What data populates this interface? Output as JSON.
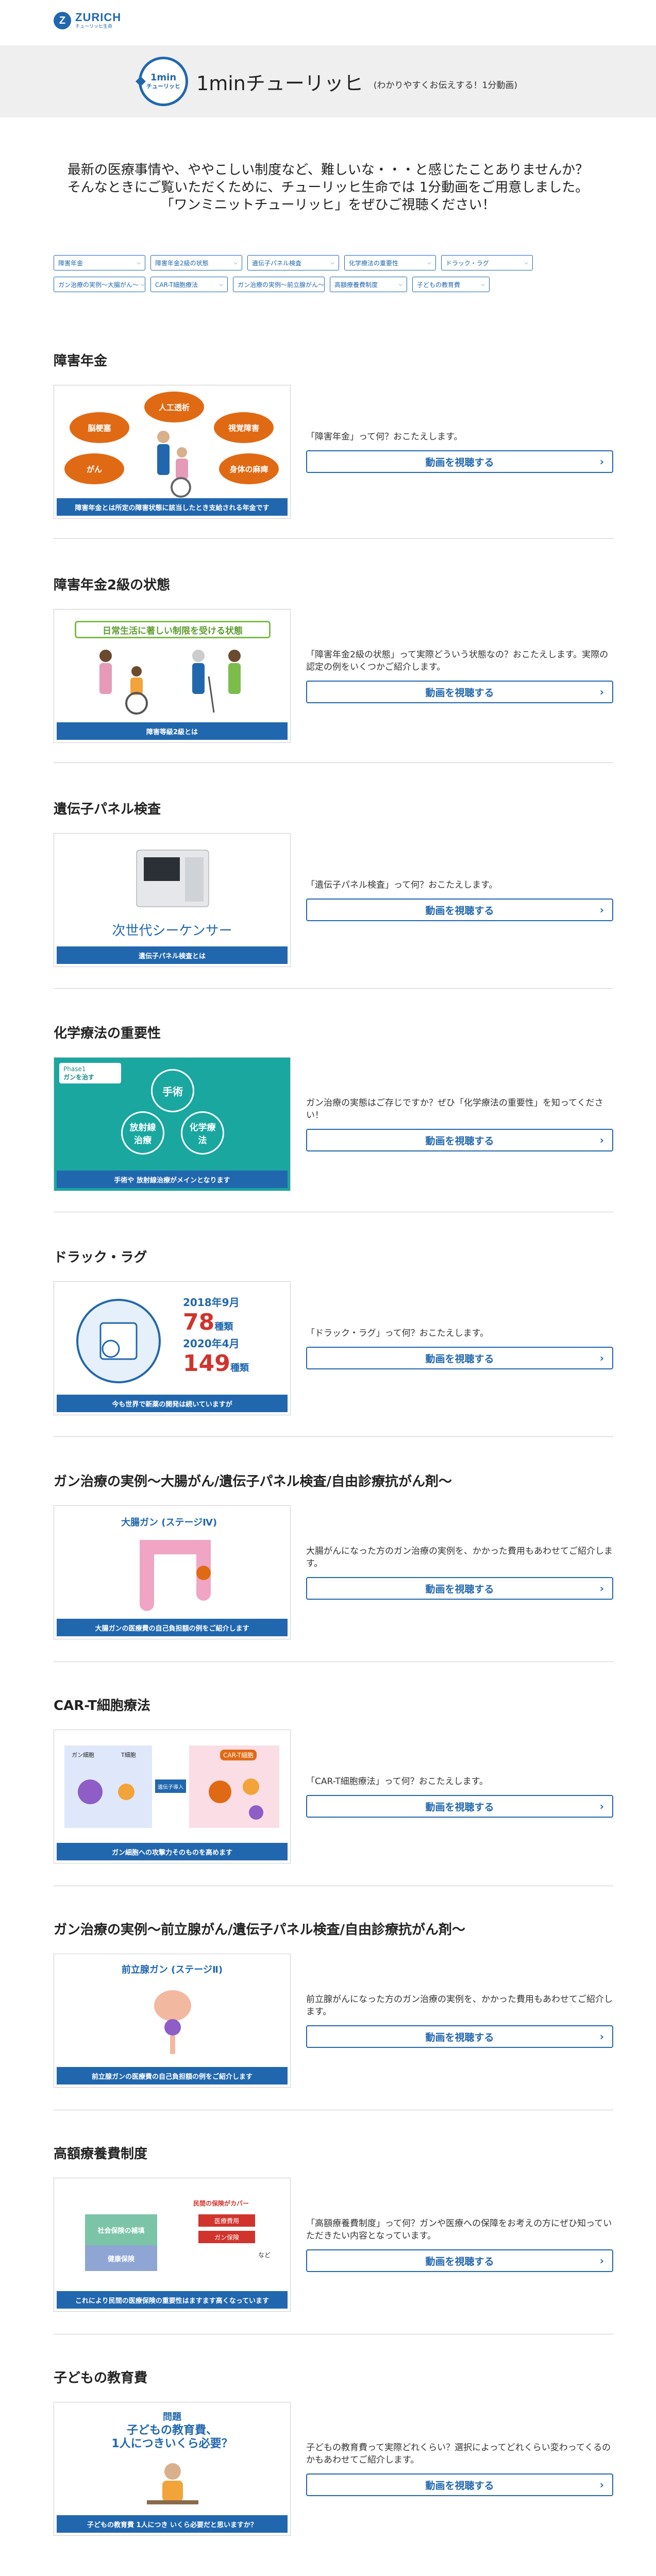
{
  "header": {
    "logo_letter": "Z",
    "logo_name": "ZURICH",
    "logo_sub": "チューリッヒ生命"
  },
  "band": {
    "icon_top": "1min",
    "icon_bottom": "チューリッヒ",
    "title": "1minチューリッヒ",
    "subtitle": "(わかりやすくお伝えする！1分動画)"
  },
  "intro": {
    "line1": "最新の医療事情や、ややこしい制度など、難しいな・・・と感じたことありませんか？",
    "line2": "そんなときにご覧いただくために、チューリッヒ生命では 1分動画をご用意しました。",
    "line3": "「ワンミニットチューリッヒ」をぜひご視聴ください！"
  },
  "tags": [
    "障害年金",
    "障害年金2級の状態",
    "遺伝子パネル検査",
    "化学療法の重要性",
    "ドラック・ラグ",
    "ガン治療の実例〜大腸がん〜",
    "CAR-T細胞療法",
    "ガン治療の実例〜前立腺がん〜",
    "高額療養費制度",
    "子どもの教育費"
  ],
  "button_label": "動画を視聴する",
  "sections": [
    {
      "title": "障害年金",
      "caption": "障害年金とは所定の障害状態に該当したとき支給される年金です",
      "desc": "「障害年金」って何？おこたえします。",
      "ovals": [
        "人工透析",
        "脳梗塞",
        "視覚障害",
        "がん",
        "身体の麻痺"
      ]
    },
    {
      "title": "障害年金2級の状態",
      "caption": "障害等級2級とは",
      "desc": "「障害年金2級の状態」って実際どういう状態なの？おこたえします。実際の認定の例をいくつかご紹介します。",
      "banner": "日常生活に著しい制限を受ける状態"
    },
    {
      "title": "遺伝子パネル検査",
      "caption": "遺伝子パネル検査とは",
      "desc": "「遺伝子パネル検査」って何？おこたえします。",
      "label": "次世代シーケンサー"
    },
    {
      "title": "化学療法の重要性",
      "caption": "手術や 放射線治療がメインとなります",
      "desc": "ガン治療の実態はご存じですか？ぜひ「化学療法の重要性」を知ってください！",
      "phase": "Phase1",
      "phase_sub": "ガンを治す",
      "c1": "手術",
      "c2": "放射線治療",
      "c3": "化学療法"
    },
    {
      "title": "ドラック・ラグ",
      "caption": "今も世界で新薬の開発は続いていますが",
      "desc": "「ドラック・ラグ」って何？おこたえします。",
      "d1": "2018年9月",
      "n1": "78",
      "u1": "種類",
      "d2": "2020年4月",
      "n2": "149",
      "u2": "種類"
    },
    {
      "title": "ガン治療の実例〜大腸がん/遺伝子パネル検査/自由診療抗がん剤〜",
      "caption": "大腸ガンの医療費の自己負担額の例をご紹介します",
      "desc": "大腸がんになった方のガン治療の実例を、かかった費用もあわせてご紹介します。",
      "label": "大腸ガン (ステージⅣ)"
    },
    {
      "title": "CAR-T細胞療法",
      "caption": "ガン細胞への攻撃力そのものを高めます",
      "desc": "「CAR-T細胞療法」って何？おこたえします。",
      "l1": "ガン細胞",
      "l2": "T細胞",
      "l3": "遺伝子導入",
      "l4": "CAR-T細胞"
    },
    {
      "title": "ガン治療の実例〜前立腺がん/遺伝子パネル検査/自由診療抗がん剤〜",
      "caption": "前立腺ガンの医療費の自己負担額の例をご紹介します",
      "desc": "前立腺がんになった方のガン治療の実例を、かかった費用もあわせてご紹介します。",
      "label": "前立腺ガン (ステージⅡ)"
    },
    {
      "title": "高額療養費制度",
      "caption": "これにより民間の医療保険の重要性はますます高くなっています",
      "desc": "「高額療養費制度」って何？ガンや医療への保障をお考えの方にぜひ知っていただきたい内容となっています。",
      "b1": "社会保険の補填",
      "b2": "健康保険",
      "r1": "民間の保険がカバー",
      "r2": "医療費用",
      "r3": "ガン保険",
      "r4": "など"
    },
    {
      "title": "子どもの教育費",
      "caption": "子どもの教育費 1人につき いくら必要だと思いますか？",
      "desc": "子どもの教育費って実際どれくらい？選択によってどれくらい変わってくるのかもあわせてご紹介します。",
      "q1": "問題",
      "q2": "子どもの教育費、",
      "q3": "1人につきいくら必要？"
    }
  ],
  "colors": {
    "accent": "#2167ae",
    "orange": "#e06a14",
    "teal": "#1aa7a0",
    "band": "#efefef"
  }
}
